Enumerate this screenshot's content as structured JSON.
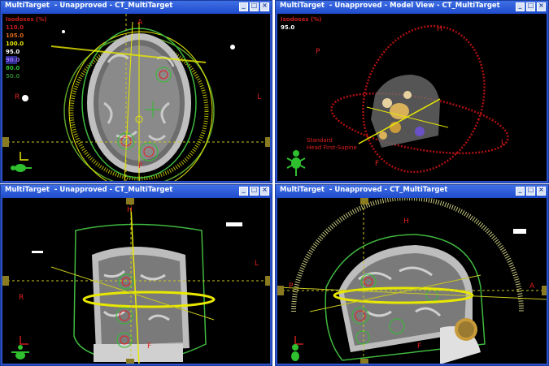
{
  "windows": {
    "tl": {
      "title": "MultiTarget  - Unapproved - CT_MultiTarget"
    },
    "tr": {
      "title": "MultiTarget  - Unapproved - Model View - CT_MultiTarget"
    },
    "bl": {
      "title": "MultiTarget  - Unapproved - CT_MultiTarget"
    },
    "br": {
      "title": "MultiTarget  - Unapproved - CT_MultiTarget"
    }
  },
  "window_buttons": {
    "minimize": "_",
    "maximize": "□",
    "close": "×"
  },
  "isodose_legend": {
    "header": "Isodoses (%)",
    "levels": [
      {
        "value": "110.0",
        "color": "#c81e1e"
      },
      {
        "value": "105.0",
        "color": "#e06a18"
      },
      {
        "value": "100.0",
        "color": "#e8e800"
      },
      {
        "value": "95.0",
        "color": "#ffffff"
      },
      {
        "value": "90.0",
        "color": "#9a6cff"
      },
      {
        "value": "80.0",
        "color": "#2fbf2f"
      },
      {
        "value": "50.0",
        "color": "#2a7a2a"
      }
    ]
  },
  "model_legend": {
    "header": "Isodoses (%)",
    "value": "95.0"
  },
  "orientation": {
    "tl": {
      "top": "A",
      "left": "R",
      "right": "L",
      "bottom": "P"
    },
    "tr": {
      "a": "H",
      "b": "P",
      "c": "L",
      "d": "F"
    },
    "bl": {
      "top": "H",
      "left": "R",
      "right": "L",
      "bottom": "F"
    },
    "br": {
      "top": "H",
      "left": "P",
      "right": "A",
      "bottom": "F"
    }
  },
  "patient_position": {
    "line1": "Standard",
    "line2": "Head First-Supine"
  },
  "icons": [
    "patient-figure-icon",
    "window-minimize-icon",
    "window-maximize-icon",
    "window-close-icon"
  ]
}
